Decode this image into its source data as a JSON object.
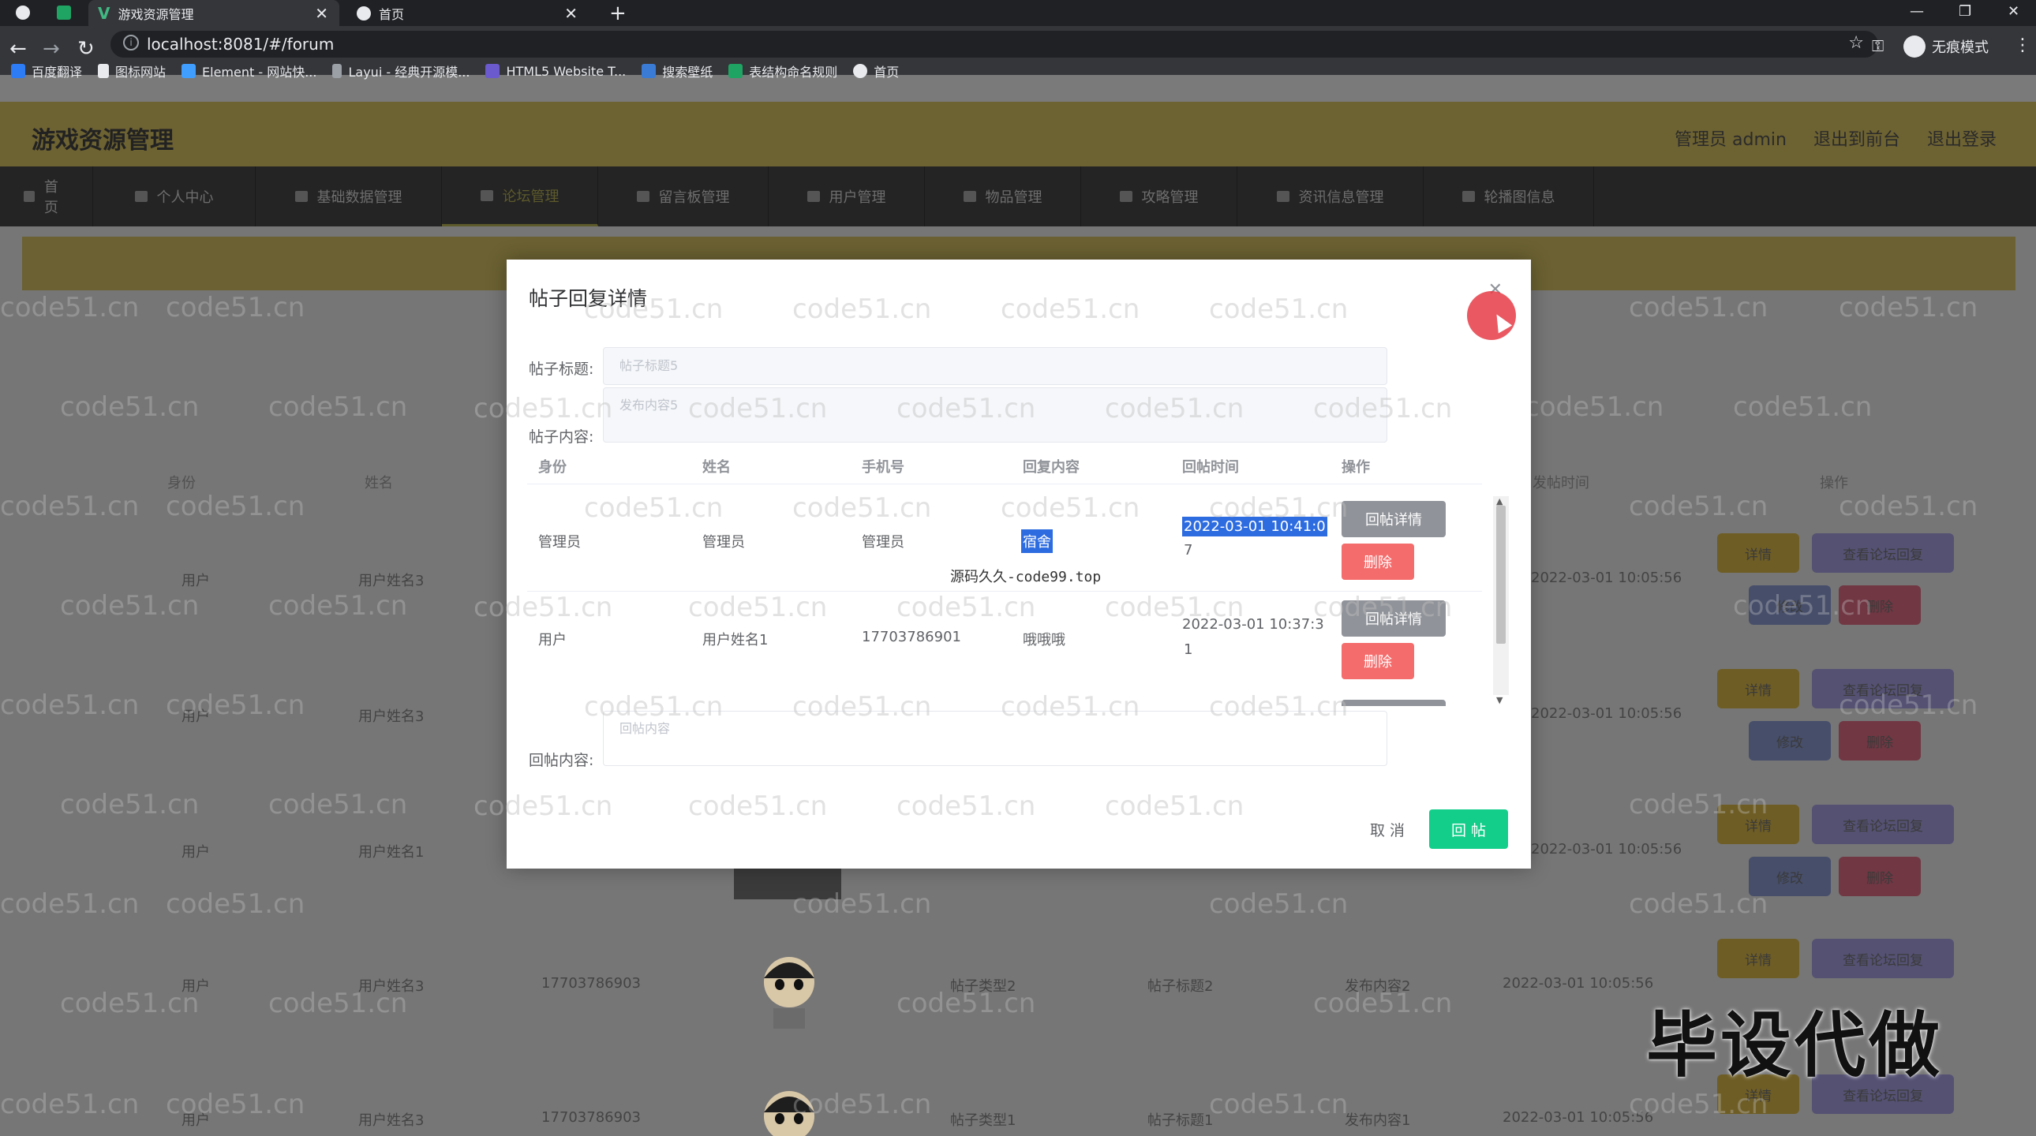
{
  "browser": {
    "tabs": [
      {
        "title": "游戏资源管理",
        "active": true
      },
      {
        "title": "首页",
        "active": false
      }
    ],
    "url": "localhost:8081/#/forum",
    "incognito_label": "无痕模式",
    "bookmarks": [
      "百度翻译",
      "图标网站",
      "Element - 网站快...",
      "Layui - 经典开源模...",
      "HTML5 Website T...",
      "搜索壁纸",
      "表结构命名规则",
      "首页"
    ]
  },
  "app": {
    "title": "游戏资源管理",
    "header_links": [
      "管理员 admin",
      "退出到前台",
      "退出登录"
    ],
    "nav": [
      "首页",
      "个人中心",
      "基础数据管理",
      "论坛管理",
      "留言板管理",
      "用户管理",
      "物品管理",
      "攻略管理",
      "资讯信息管理",
      "轮播图信息"
    ],
    "active_nav": "论坛管理",
    "bg_table": {
      "headers": [
        "身份",
        "姓名",
        "发帖时间",
        "操作"
      ],
      "rows": [
        {
          "role": "用户",
          "name": "用户姓名3",
          "phone": "",
          "type": "",
          "title": "",
          "content": "",
          "time": "2022-03-01 10:05:56"
        },
        {
          "role": "用户",
          "name": "用户姓名3",
          "phone": "",
          "type": "",
          "title": "",
          "content": "",
          "time": "2022-03-01 10:05:56"
        },
        {
          "role": "用户",
          "name": "用户姓名1",
          "phone": "",
          "type": "",
          "title": "",
          "content": "",
          "time": "2022-03-01 10:05:56"
        },
        {
          "role": "用户",
          "name": "用户姓名3",
          "phone": "17703786903",
          "type": "帖子类型2",
          "title": "帖子标题2",
          "content": "发布内容2",
          "time": "2022-03-01 10:05:56"
        },
        {
          "role": "用户",
          "name": "用户姓名3",
          "phone": "17703786903",
          "type": "帖子类型1",
          "title": "帖子标题1",
          "content": "发布内容1",
          "time": "2022-03-01 10:05:56"
        }
      ],
      "buttons": {
        "detail": "详情",
        "view_reply": "查看论坛回复",
        "edit": "修改",
        "delete": "删除"
      }
    },
    "watermark": "code51.cn"
  },
  "modal": {
    "title": "帖子回复详情",
    "post_title_label": "帖子标题:",
    "post_title_placeholder": "帖子标题5",
    "post_content_label": "帖子内容:",
    "post_content_placeholder": "发布内容5",
    "table_headers": [
      "身份",
      "姓名",
      "手机号",
      "回复内容",
      "回帖时间",
      "操作"
    ],
    "rows": [
      {
        "role": "管理员",
        "name": "管理员",
        "phone": "管理员",
        "content": "宿舍",
        "time_line1": "2022-03-01 10:41:0",
        "time_line2": "7",
        "detail_btn": "回帖详情",
        "delete_btn": "删除"
      },
      {
        "role": "用户",
        "name": "用户姓名1",
        "phone": "17703786901",
        "content": "哦哦哦",
        "time_line1": "2022-03-01 10:37:3",
        "time_line2": "1",
        "detail_btn": "回帖详情",
        "delete_btn": "删除"
      }
    ],
    "reply_label": "回帖内容:",
    "reply_placeholder": "回帖内容",
    "cancel_btn": "取 消",
    "submit_btn": "回 帖",
    "source_note": "源码久久-code99.top"
  },
  "overlay_text": "毕设代做"
}
